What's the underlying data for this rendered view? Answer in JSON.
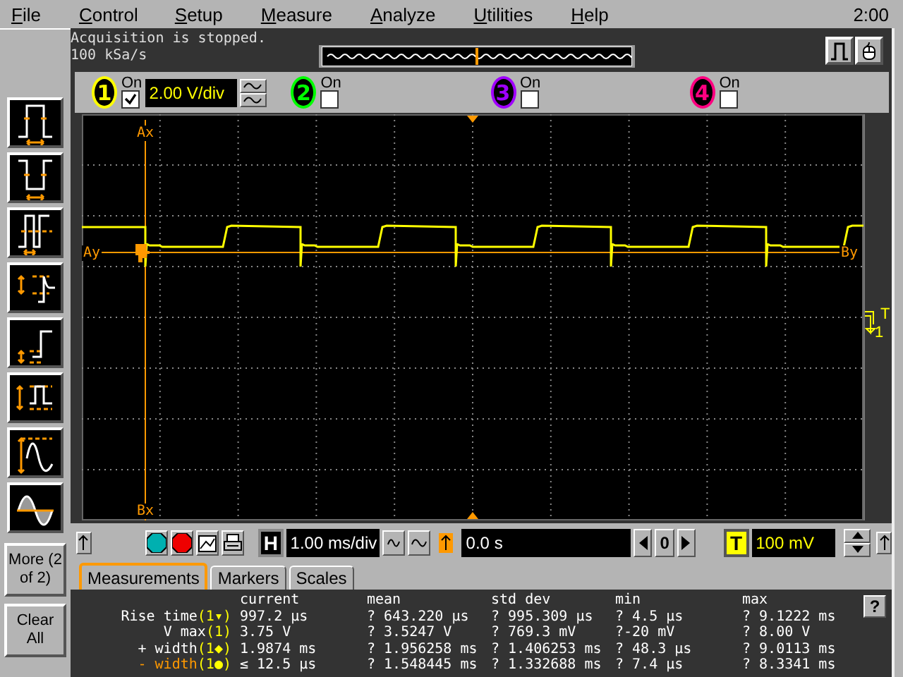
{
  "menu": [
    {
      "label": "File"
    },
    {
      "label": "Control"
    },
    {
      "label": "Setup"
    },
    {
      "label": "Measure"
    },
    {
      "label": "Analyze"
    },
    {
      "label": "Utilities"
    },
    {
      "label": "Help"
    }
  ],
  "clock": "2:00",
  "status": {
    "lines": [
      "Acquisition is stopped.",
      "100 kSa/s"
    ]
  },
  "channels": [
    {
      "number": "1",
      "on_label": "On",
      "on": true,
      "scale": "2.00 V/div",
      "color": "#ffff00"
    },
    {
      "number": "2",
      "on_label": "On",
      "on": false,
      "color": "#00ff00"
    },
    {
      "number": "3",
      "on_label": "On",
      "on": false,
      "color": "#a000ff"
    },
    {
      "number": "4",
      "on_label": "On",
      "on": false,
      "color": "#ff0080"
    }
  ],
  "toolbar": {
    "more": "More (2 of 2)",
    "clear": "Clear All"
  },
  "markers": [
    {
      "label": "Ax"
    },
    {
      "label": "Ay"
    },
    {
      "label": "Bx"
    },
    {
      "label": "By"
    }
  ],
  "trigger_marker": {
    "label": "T",
    "source": "1"
  },
  "controls": {
    "horizontal_label": "H",
    "time_scale": "1.00 ms/div",
    "delay": "0.0 s",
    "delay_reset": "0",
    "trigger_label": "T",
    "trigger_level": "100 mV"
  },
  "tabs": [
    {
      "label": "Measurements",
      "selected": true
    },
    {
      "label": "Markers",
      "selected": false
    },
    {
      "label": "Scales",
      "selected": false
    }
  ],
  "help_button": "?",
  "table": {
    "columns": [
      "current",
      "mean",
      "std dev",
      "min",
      "max"
    ],
    "rows": [
      {
        "name": "Rise time",
        "source": "(1▾)",
        "selected": false,
        "cells": [
          "997.2 µs",
          "? 643.220 µs",
          "? 995.309 µs",
          "? 4.5 µs",
          "? 9.1222 ms"
        ]
      },
      {
        "name": "V max",
        "source": "(1)",
        "selected": false,
        "cells": [
          "3.75 V",
          "? 3.5247 V",
          "? 769.3 mV",
          "?-20 mV",
          "? 8.00 V"
        ]
      },
      {
        "name": "+ width",
        "source": "(1◆)",
        "selected": false,
        "cells": [
          "1.9874 ms",
          "? 1.956258 ms",
          "? 1.406253 ms",
          "? 48.3 µs",
          "? 9.0113 ms"
        ]
      },
      {
        "name": "- width",
        "source": "(1●)",
        "selected": true,
        "cells": [
          "≤ 12.5 µs",
          "? 1.548445 ms",
          "? 1.332688 ms",
          "? 7.4 µs",
          "? 8.3341 ms"
        ]
      }
    ]
  }
}
